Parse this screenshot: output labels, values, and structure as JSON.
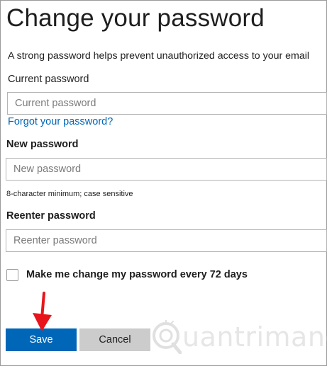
{
  "page": {
    "title": "Change your password",
    "description": "A strong password helps prevent unauthorized access to your email"
  },
  "current_password": {
    "label": "Current password",
    "placeholder": "Current password",
    "value": ""
  },
  "forgot_link": "Forgot your password?",
  "new_password": {
    "label": "New password",
    "placeholder": "New password",
    "value": "",
    "hint": "8-character minimum; case sensitive"
  },
  "reenter_password": {
    "label": "Reenter password",
    "placeholder": "Reenter password",
    "value": ""
  },
  "expire_option": {
    "label": "Make me change my password every 72 days",
    "checked": false
  },
  "buttons": {
    "save": "Save",
    "cancel": "Cancel"
  },
  "annotation": {
    "arrow_icon": "red-arrow-down-icon",
    "arrow_color": "#e8141b"
  },
  "watermark": {
    "text": "uantrimang",
    "icon": "quantrimang-logo-icon"
  },
  "colors": {
    "primary": "#0067b8",
    "secondary_button": "#cccccc",
    "link": "#0067b8"
  }
}
